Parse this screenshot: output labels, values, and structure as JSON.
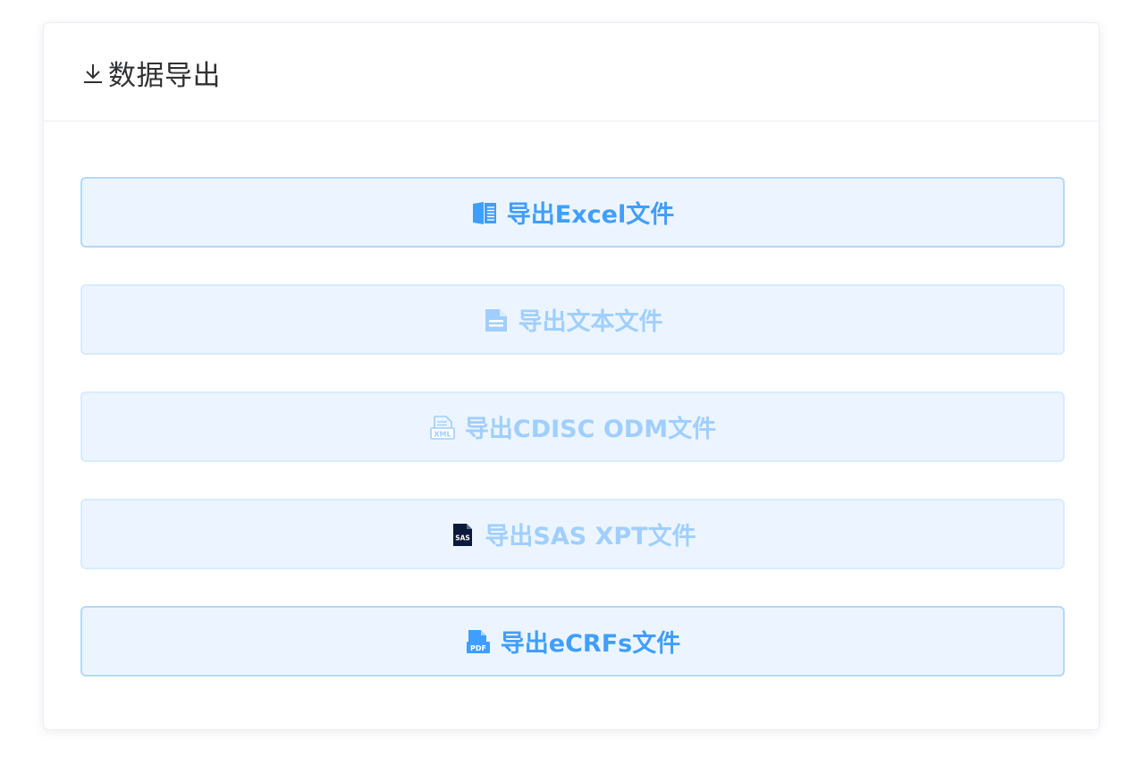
{
  "panel": {
    "title": "数据导出",
    "title_icon": "download-icon"
  },
  "buttons": [
    {
      "label": "导出Excel文件",
      "icon": "excel-book-icon",
      "disabled": false
    },
    {
      "label": "导出文本文件",
      "icon": "text-file-icon",
      "disabled": true
    },
    {
      "label": "导出CDISC ODM文件",
      "icon": "xml-file-icon",
      "icon_text": "XML",
      "disabled": true
    },
    {
      "label": "导出SAS XPT文件",
      "icon": "sas-file-icon",
      "icon_text": "SAS",
      "disabled": true
    },
    {
      "label": "导出eCRFs文件",
      "icon": "pdf-file-icon",
      "icon_text": "PDF",
      "disabled": false
    }
  ],
  "colors": {
    "primary": "#409eff",
    "primary_light": "#a0cfff",
    "button_bg": "#ecf5ff",
    "button_border": "#b3d8ff",
    "sas_icon": "#0b1a3a"
  }
}
